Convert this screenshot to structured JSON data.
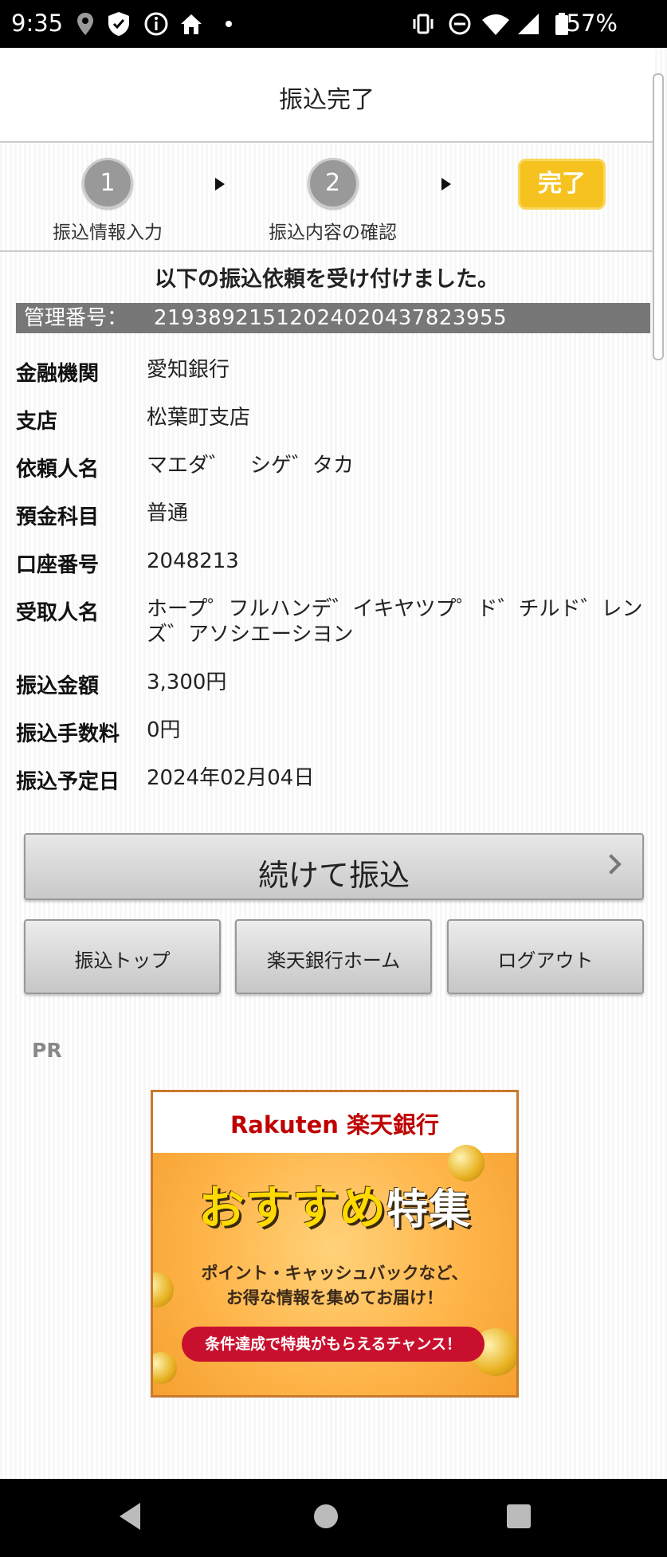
{
  "status_bar": {
    "time": "9:35",
    "battery": "57%",
    "icons": [
      "location-icon",
      "shield-icon",
      "info-icon",
      "home-icon",
      "dot-icon",
      "vibrate-icon",
      "dnd-icon",
      "wifi-icon",
      "signal-icon",
      "battery-icon"
    ]
  },
  "header": {
    "title": "振込完了"
  },
  "steps": [
    {
      "number": "1",
      "label": "振込情報入力"
    },
    {
      "number": "2",
      "label": "振込内容の確認"
    },
    {
      "label": "完了"
    }
  ],
  "message": "以下の振込依頼を受け付けました。",
  "management": {
    "label": "管理番号：",
    "value": "2193892151202402043782395​5"
  },
  "details": [
    {
      "label": "金融機関",
      "value": "愛知銀行"
    },
    {
      "label": "支店",
      "value": "松葉町支店"
    },
    {
      "label": "依頼人名",
      "value": "マエダ゛　シゲ゛タカ"
    },
    {
      "label": "預金科目",
      "value": "普通"
    },
    {
      "label": "口座番号",
      "value": "2048213"
    },
    {
      "label": "受取人名",
      "value": "ホープ゜フルハンデ゛イキヤツプ゜ド゛チルド゛レンズ゛アソシエーシヨン"
    },
    {
      "label": "振込金額",
      "value": "3,300円"
    },
    {
      "label": "振込手数料",
      "value": "0円"
    },
    {
      "label": "振込予定日",
      "value": "2024年02月04日"
    }
  ],
  "buttons": {
    "continue": "続けて振込",
    "transfer_top": "振込トップ",
    "bank_home": "楽天銀行ホーム",
    "logout": "ログアウト"
  },
  "pr": {
    "label": "PR",
    "banner": {
      "logo": "Rakuten 楽天銀行",
      "title_main": "おすすめ",
      "title_sub": "特集",
      "subtitle_line1": "ポイント・キャッシュバックなど、",
      "subtitle_line2": "お得な情報を集めてお届け！",
      "cta": "条件達成で特典がもらえるチャンス！"
    }
  },
  "colors": {
    "step_active": "#f5c220",
    "step_inactive": "#999999",
    "management_bar": "#777777",
    "rakuten_red": "#bf0000"
  }
}
